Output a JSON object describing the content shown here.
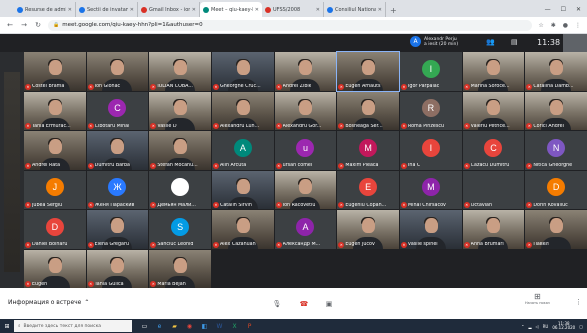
{
  "browser": {
    "tabs": [
      {
        "label": "Resurse de administrare de...",
        "color": "#1a73e8",
        "active": false
      },
      {
        "label": "Sectii de invatamant - Centr...",
        "color": "#1a73e8",
        "active": false
      },
      {
        "label": "Gmail Inbox - ion.slegnesi777...",
        "color": "#d93025",
        "active": false
      },
      {
        "label": "Meet – qiu-kaey-hhn",
        "color": "#00897b",
        "active": true
      },
      {
        "label": "UFSS/2008",
        "color": "#d93025",
        "active": false
      },
      {
        "label": "Consiliul National de Tehn...",
        "color": "#1a73e8",
        "active": false
      }
    ],
    "new_tab": "+",
    "url": "meet.google.com/qiu-kaey-hhn?pli=1&authuser=0"
  },
  "meet": {
    "presenter_initial": "A",
    "presenter_name": "Alexandr Perju",
    "presenter_status": "a iesit (20 min)",
    "clock": "11:38",
    "meeting_info": "Информация о встрече",
    "present_label": "Начать показ",
    "participants": [
      {
        "name": "Costel Brama",
        "type": "cam",
        "tone": "c1"
      },
      {
        "name": "Ion Glonac",
        "type": "cam",
        "tone": "c1"
      },
      {
        "name": "IULIAN COBA...",
        "type": "cam",
        "tone": "c2"
      },
      {
        "name": "Gheorghe Cruc...",
        "type": "cam",
        "tone": "c3"
      },
      {
        "name": "Andrei Zibik",
        "type": "cam",
        "tone": "c2"
      },
      {
        "name": "Eugen Arnauts",
        "type": "cam",
        "tone": "c1",
        "active": true
      },
      {
        "name": "Igor Parpalac",
        "type": "avatar",
        "initial": "I",
        "color": "#34a853"
      },
      {
        "name": "Marina Soroce...",
        "type": "cam",
        "tone": "c2"
      },
      {
        "name": "Cătălina Damb...",
        "type": "cam",
        "tone": "c2"
      },
      {
        "name": "Tania Ermurac...",
        "type": "cam",
        "tone": "c2"
      },
      {
        "name": "Cibotaru Mihai",
        "type": "avatar",
        "initial": "C",
        "color": "#9c27b0"
      },
      {
        "name": "Vasile D",
        "type": "cam",
        "tone": "c2"
      },
      {
        "name": "Alexandru Lun...",
        "type": "cam",
        "tone": "c1"
      },
      {
        "name": "Alexandru Gor...",
        "type": "cam",
        "tone": "c2"
      },
      {
        "name": "Bosneaga Ser...",
        "type": "cam",
        "tone": "c1"
      },
      {
        "name": "Roma Pinzescu",
        "type": "avatar",
        "initial": "R",
        "color": "#8d6e63"
      },
      {
        "name": "Valeriu Petrice...",
        "type": "cam",
        "tone": "c2"
      },
      {
        "name": "Corici Andrei",
        "type": "cam",
        "tone": "c2"
      },
      {
        "name": "Andrei Rata",
        "type": "cam",
        "tone": "c1"
      },
      {
        "name": "Dumitru Barba",
        "type": "cam",
        "tone": "c3"
      },
      {
        "name": "Stefan Mocanu...",
        "type": "cam",
        "tone": "c1"
      },
      {
        "name": "Alin Arcuta",
        "type": "avatar",
        "initial": "A",
        "color": "#00897b"
      },
      {
        "name": "ursan comel",
        "type": "avatar",
        "initial": "u",
        "color": "#9c27b0"
      },
      {
        "name": "Maxim Pleaca",
        "type": "avatar",
        "initial": "M",
        "color": "#c2185b"
      },
      {
        "name": "Ina C",
        "type": "avatar",
        "initial": "I",
        "color": "#e8453c"
      },
      {
        "name": "Cazacu Dumitru",
        "type": "avatar",
        "initial": "C",
        "color": "#e8453c"
      },
      {
        "name": "Nitica Gheorghe",
        "type": "avatar",
        "initial": "N",
        "color": "#7e57c2"
      },
      {
        "name": "Jubea Sergiu",
        "type": "avatar",
        "initial": "J",
        "color": "#f57c00"
      },
      {
        "name": "Женя Параскив",
        "type": "avatar",
        "initial": "Ж",
        "color": "#2979ff"
      },
      {
        "name": "Демьян Мали...",
        "type": "avatar",
        "initial": "",
        "color": "#ffffff"
      },
      {
        "name": "Catalin Sirvin",
        "type": "cam",
        "tone": "c3"
      },
      {
        "name": "Ion Racovetiu",
        "type": "cam",
        "tone": "c2"
      },
      {
        "name": "Eugeniu Copan...",
        "type": "avatar",
        "initial": "E",
        "color": "#e8453c"
      },
      {
        "name": "Mihai Chirsacov",
        "type": "avatar",
        "initial": "M",
        "color": "#8e24aa"
      },
      {
        "name": "Octavian",
        "type": "avatar",
        "initial": "",
        "color": "#3c4043"
      },
      {
        "name": "Dorin Kovaliuc",
        "type": "avatar",
        "initial": "D",
        "color": "#f57c00"
      },
      {
        "name": "Daniel Bolnaru",
        "type": "avatar",
        "initial": "D",
        "color": "#e8453c"
      },
      {
        "name": "Elena Gregaru",
        "type": "cam",
        "tone": "c3"
      },
      {
        "name": "Sanciuc Leonid",
        "type": "avatar",
        "initial": "S",
        "color": "#039be5"
      },
      {
        "name": "Alex Cazahuan",
        "type": "cam",
        "tone": "c1"
      },
      {
        "name": "Александр М...",
        "type": "avatar",
        "initial": "A",
        "color": "#8e24aa"
      },
      {
        "name": "Eugen Jucov",
        "type": "cam",
        "tone": "c2"
      },
      {
        "name": "vasile spinei",
        "type": "cam",
        "tone": "c3"
      },
      {
        "name": "Anna Brumari",
        "type": "cam",
        "tone": "c2"
      },
      {
        "name": "Павел",
        "type": "cam",
        "tone": "c1"
      },
      {
        "name": "Eugen",
        "type": "cam",
        "tone": "c2"
      },
      {
        "name": "Tania Gulica",
        "type": "cam",
        "tone": "c2"
      },
      {
        "name": "Maria Bejan",
        "type": "cam",
        "tone": "c1"
      },
      {
        "name": "",
        "type": "empty"
      }
    ]
  },
  "taskbar": {
    "search_placeholder": "Введите здесь текст для поиска",
    "language": "RU",
    "time": "11:38",
    "date": "06.12.2020"
  }
}
